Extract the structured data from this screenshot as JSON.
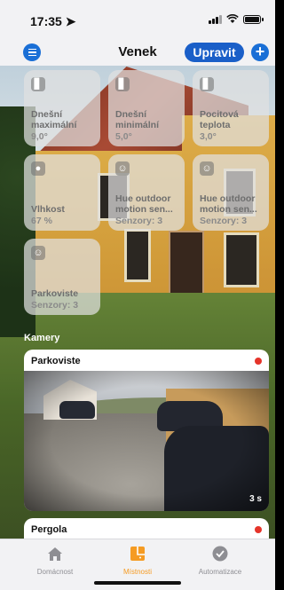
{
  "status_bar": {
    "time": "17:35 ➤"
  },
  "nav": {
    "title": "Venek",
    "edit_label": "Upravit",
    "add_label": "+"
  },
  "tiles": [
    {
      "icon": "thermometer-icon",
      "glyph": "▋",
      "name": "Dnešní maximální",
      "value": "9,0°"
    },
    {
      "icon": "thermometer-icon",
      "glyph": "▋",
      "name": "Dnešní minimální",
      "value": "5,0°"
    },
    {
      "icon": "thermometer-icon",
      "glyph": "▋",
      "name": "Pocitová teplota",
      "value": "3,0°"
    },
    {
      "icon": "humidity-icon",
      "glyph": "●",
      "name": "Vlhkost",
      "value": "67 %"
    },
    {
      "icon": "motion-sensor-icon",
      "glyph": "☺",
      "name": "Hue outdoor motion sen...",
      "value": "Senzory: 3"
    },
    {
      "icon": "motion-sensor-icon",
      "glyph": "☺",
      "name": "Hue outdoor motion sen...",
      "value": "Senzory: 3"
    },
    {
      "icon": "motion-sensor-icon",
      "glyph": "☺",
      "name": "Parkoviste",
      "value": "Senzory: 3"
    }
  ],
  "cameras_section": "Kamery",
  "cameras": [
    {
      "title": "Parkoviste",
      "duration": "3 s"
    },
    {
      "title": "Pergola"
    }
  ],
  "tabbar": {
    "tabs": [
      {
        "label": "Domácnost",
        "icon": "home-icon",
        "active": false
      },
      {
        "label": "Místnosti",
        "icon": "rooms-icon",
        "active": true
      },
      {
        "label": "Automatizace",
        "icon": "automation-icon",
        "active": false
      }
    ]
  },
  "colors": {
    "accent_blue": "#1a6fd6",
    "active_tab": "#f59b23",
    "record_red": "#e5342a"
  }
}
